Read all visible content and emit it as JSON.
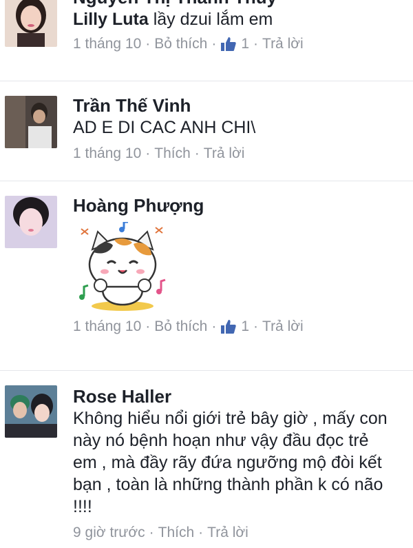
{
  "comments": [
    {
      "author": "Nguyễn Thị Thanh Thủy",
      "mention": "Lilly Luta",
      "text": "lầy dzui lắm em",
      "time": "1 tháng 10",
      "like_action": "Bỏ thích",
      "like_count": "1",
      "reply": "Trả lời"
    },
    {
      "author": "Trần Thế Vinh",
      "text": "AD E DI CAC ANH CHI\\",
      "time": "1 tháng 10",
      "like_action": "Thích",
      "reply": "Trả lời"
    },
    {
      "author": "Hoàng Phượng",
      "sticker": "cat-sticker",
      "time": "1 tháng 10",
      "like_action": "Bỏ thích",
      "like_count": "1",
      "reply": "Trả lời"
    },
    {
      "author": "Rose Haller",
      "text": "Không hiểu nổi giới trẻ bây giờ , mấy con này nó bệnh hoạn như vậy đầu đọc trẻ em , mà đầy rãy đứa ngưỡng mộ đòi kết bạn , toàn là những thành phần k có não !!!!",
      "time": "9 giờ trước",
      "like_action": "Thích",
      "reply": "Trả lời"
    }
  ],
  "separator": "·",
  "icons": {
    "like": "thumbs-up-icon"
  },
  "colors": {
    "text": "#1d2129",
    "meta": "#90949c",
    "like_blue": "#4267b2",
    "divider": "#e4e6eb"
  }
}
